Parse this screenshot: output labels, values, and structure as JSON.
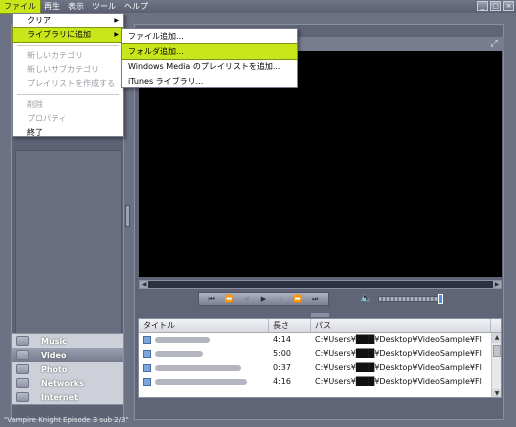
{
  "menubar": {
    "items": [
      "ファイル",
      "再生",
      "表示",
      "ツール",
      "ヘルプ"
    ],
    "window_buttons": [
      "_",
      "□",
      "×"
    ]
  },
  "file_menu": {
    "items": [
      {
        "label": "クリア",
        "submenu": true,
        "disabled": false
      },
      {
        "label": "ライブラリに追加",
        "submenu": true,
        "disabled": false,
        "highlighted": true
      },
      {
        "label": "新しいカテゴリ",
        "disabled": true
      },
      {
        "label": "新しいサブカテゴリ",
        "disabled": true
      },
      {
        "label": "プレイリストを作成する",
        "disabled": true
      },
      {
        "label": "削除",
        "disabled": true
      },
      {
        "label": "プロパティ",
        "disabled": true
      },
      {
        "label": "終了",
        "disabled": false
      }
    ]
  },
  "add_submenu": {
    "items": [
      {
        "label": "ファイル追加..."
      },
      {
        "label": "フォルダ追加...",
        "highlighted": true
      },
      {
        "label": "Windows Media のプレイリストを追加..."
      },
      {
        "label": "iTunes ライブラリ..."
      }
    ]
  },
  "categories": [
    {
      "label": "Music",
      "selected": false
    },
    {
      "label": "Video",
      "selected": true
    },
    {
      "label": "Photo",
      "selected": false
    },
    {
      "label": "Networks",
      "selected": false
    },
    {
      "label": "Internet",
      "selected": false
    }
  ],
  "transport": {
    "buttons": [
      "⏮",
      "⏪",
      "◀",
      "▶",
      "⏸",
      "⏩",
      "⏭"
    ]
  },
  "volume": {
    "level": 0.95
  },
  "media_list": {
    "columns": [
      "タイトル",
      "長さ",
      "パス"
    ],
    "rows": [
      {
        "length": "4:14",
        "path": "C:¥Users¥███¥Desktop¥VideoSample¥Fl"
      },
      {
        "length": "5:00",
        "path": "C:¥Users¥███¥Desktop¥VideoSample¥Fl"
      },
      {
        "length": "0:37",
        "path": "C:¥Users¥███¥Desktop¥VideoSample¥Fl"
      },
      {
        "length": "4:16",
        "path": "C:¥Users¥███¥Desktop¥VideoSample¥Fl"
      }
    ]
  },
  "status_text": "\"Vampire Knight Episode 3  sub 2/3\""
}
